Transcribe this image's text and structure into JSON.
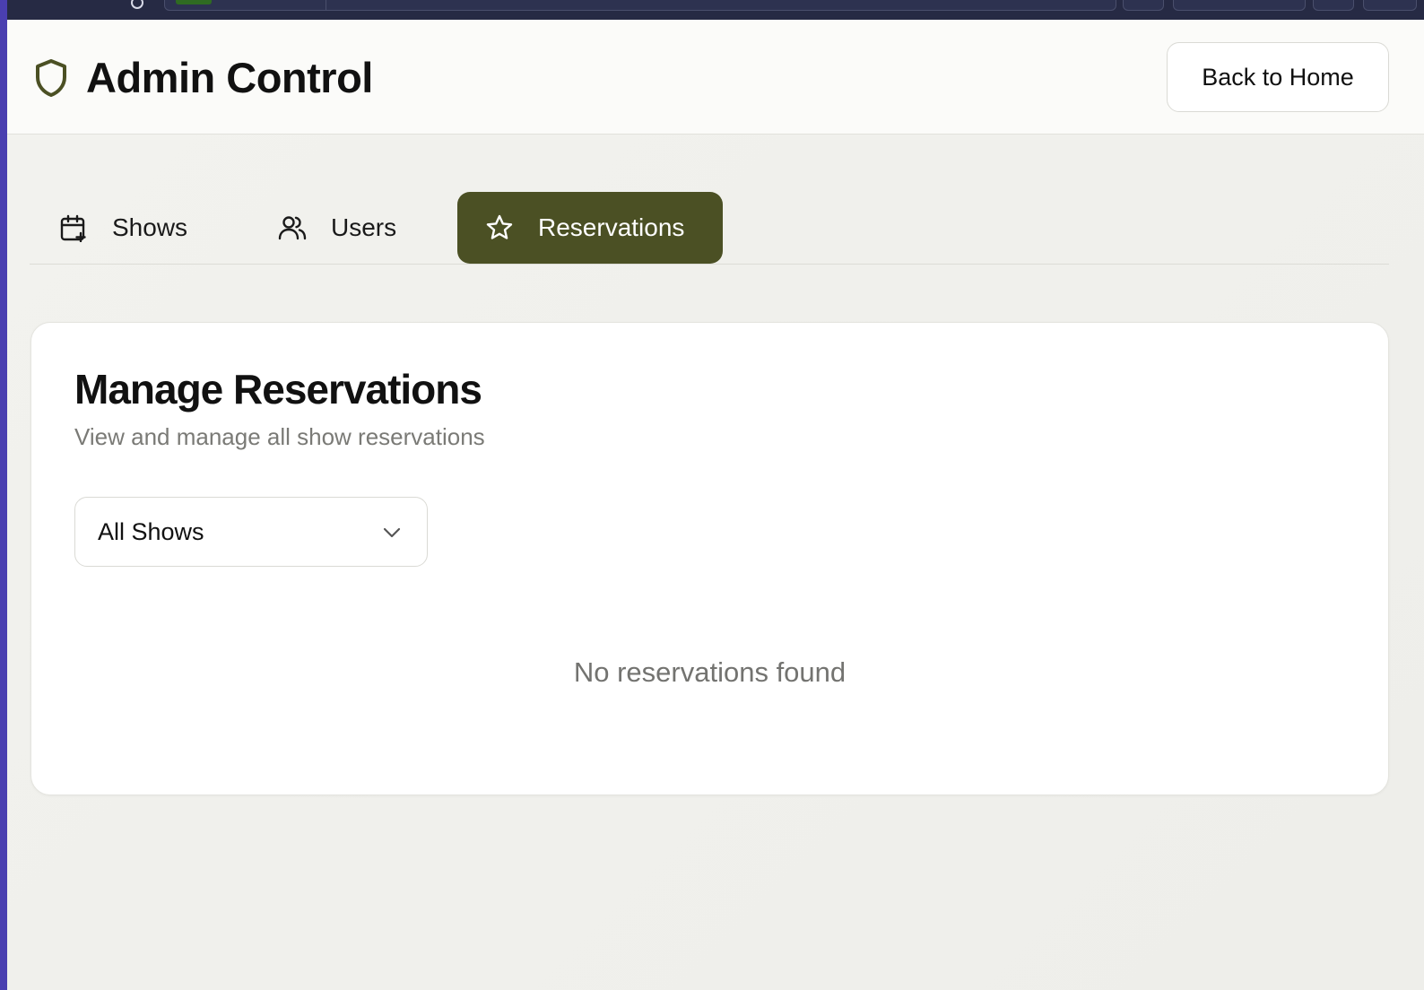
{
  "header": {
    "title": "Admin Control",
    "back_label": "Back to Home"
  },
  "tabs": [
    {
      "label": "Shows",
      "icon": "calendar-plus-icon",
      "active": false
    },
    {
      "label": "Users",
      "icon": "users-icon",
      "active": false
    },
    {
      "label": "Reservations",
      "icon": "star-icon",
      "active": true
    }
  ],
  "panel": {
    "title": "Manage Reservations",
    "subtitle": "View and manage all show reservations",
    "filter": {
      "selected": "All Shows"
    },
    "empty_message": "No reservations found"
  },
  "colors": {
    "accent": "#4b5024",
    "background": "#f0f0ec",
    "card": "#ffffff",
    "muted_text": "#7a7a76"
  }
}
